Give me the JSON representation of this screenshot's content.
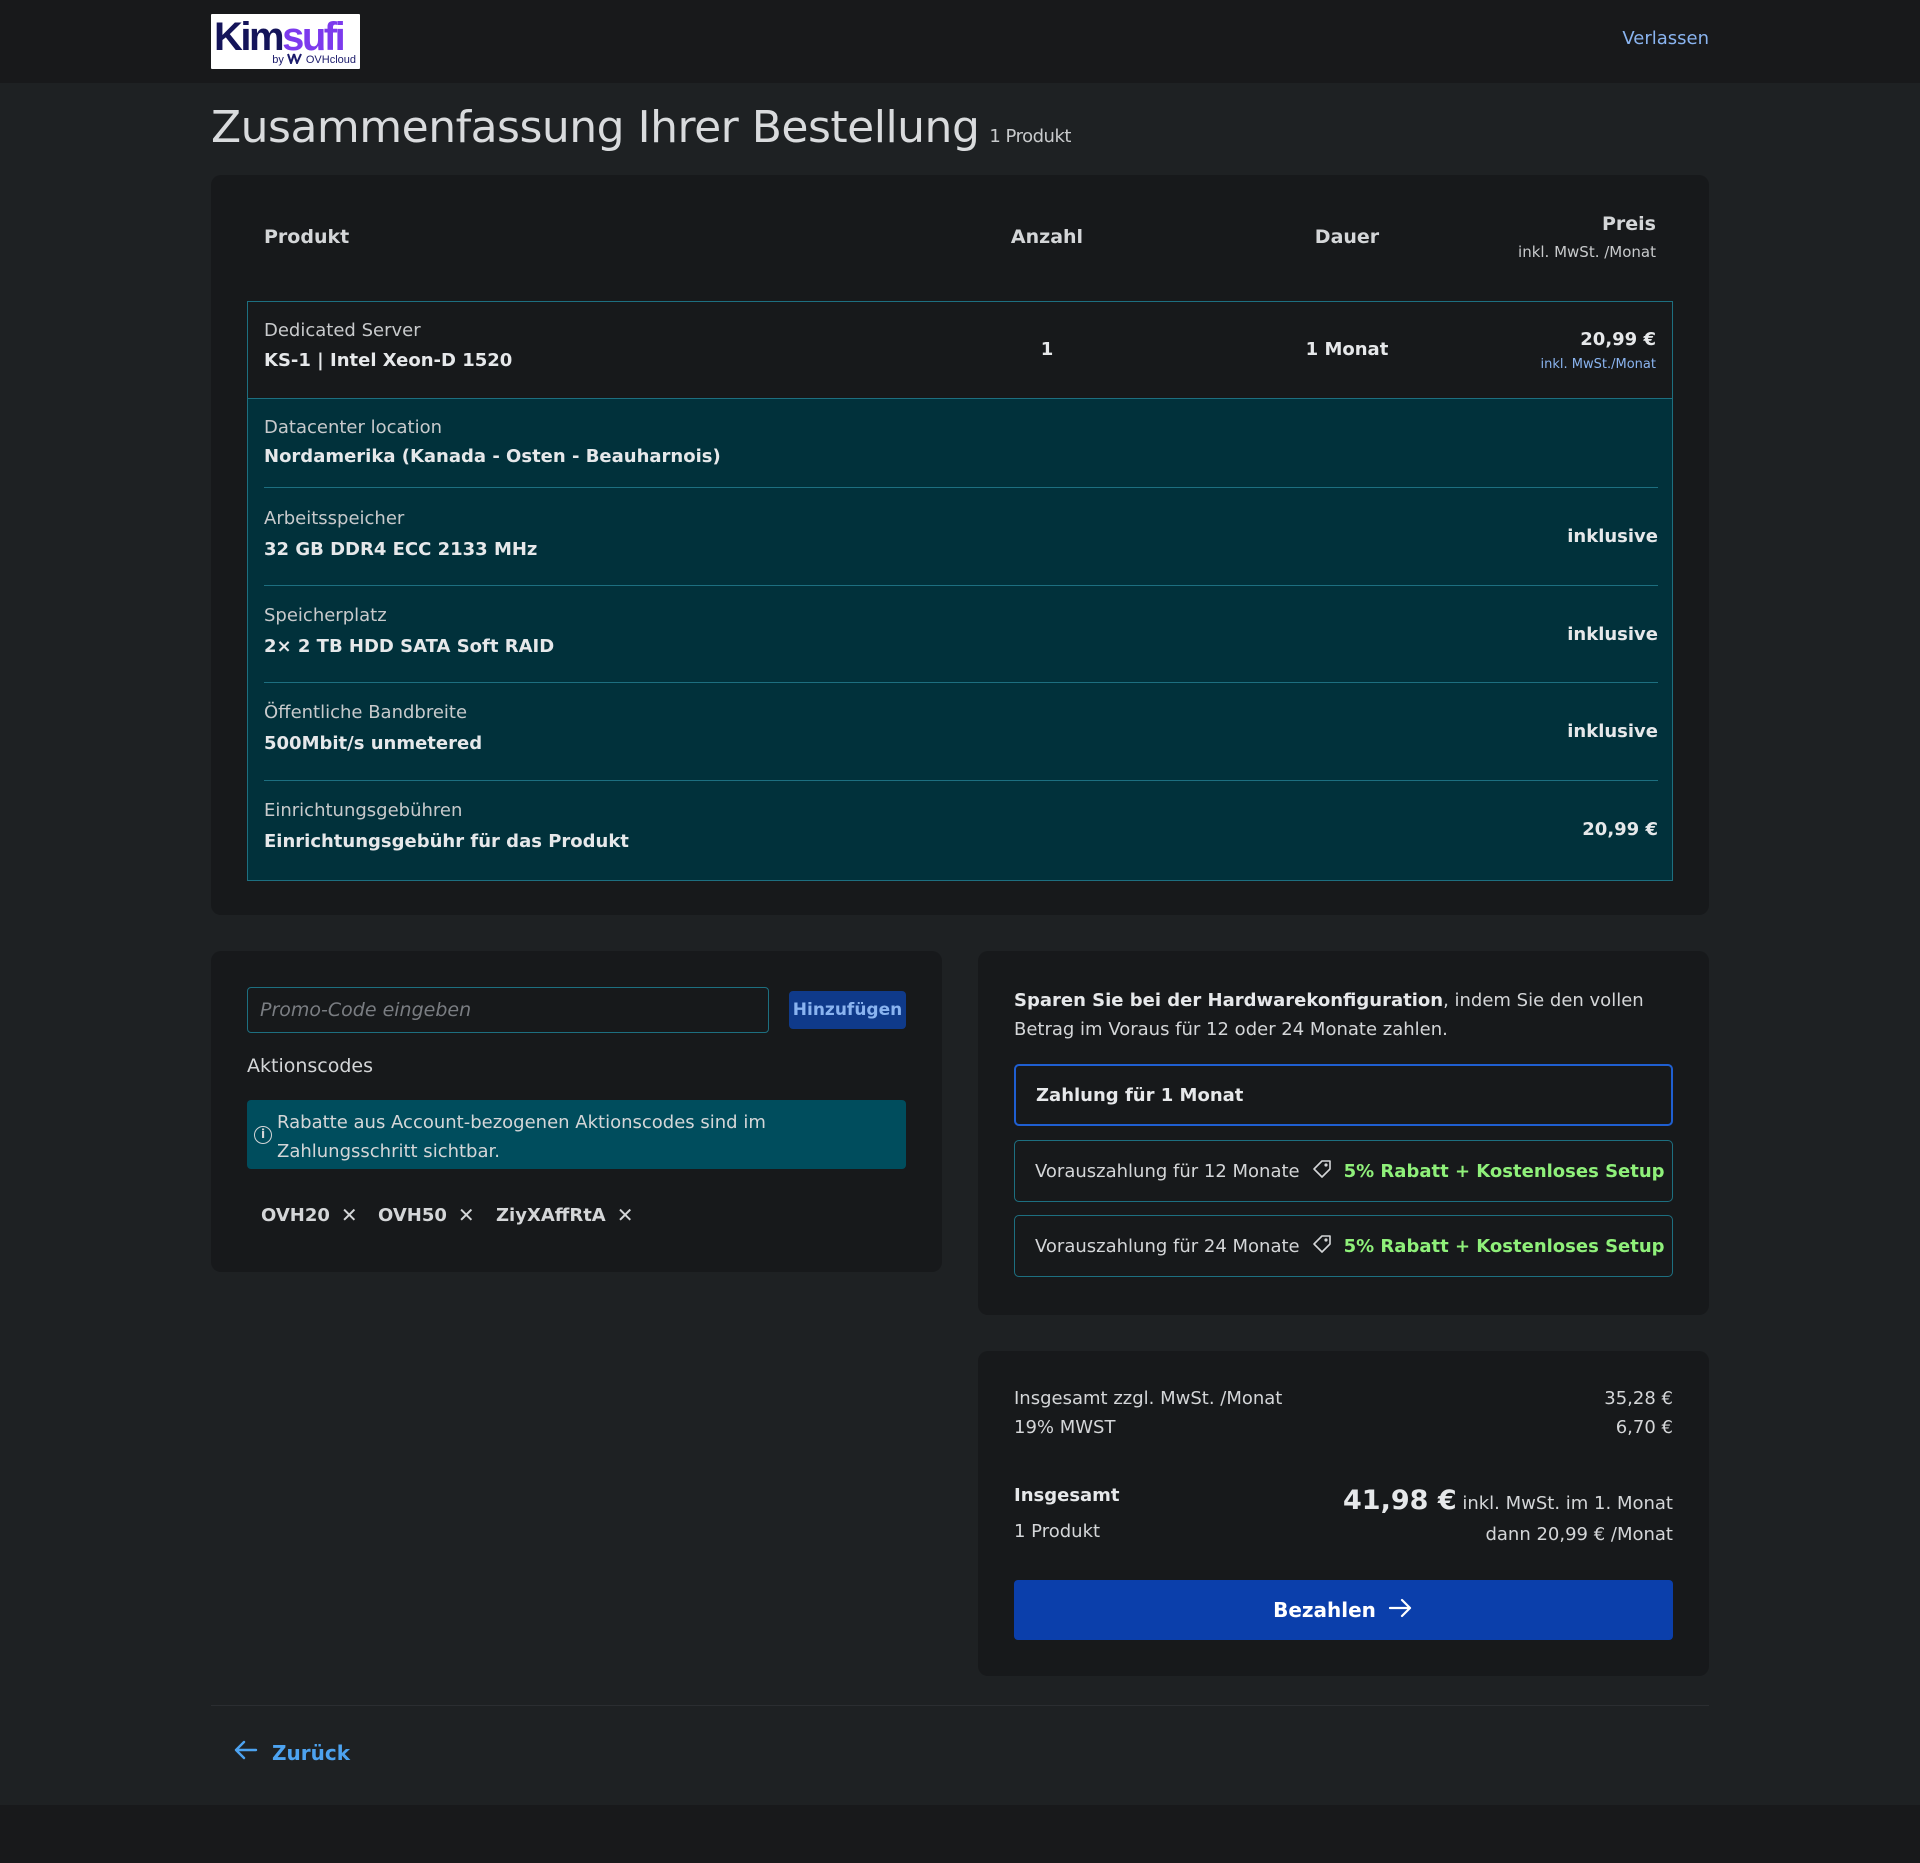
{
  "header": {
    "logo_text_1": "Kim",
    "logo_text_2": "sufi",
    "logo_by": "by",
    "logo_company": "OVHcloud",
    "exit_label": "Verlassen"
  },
  "page": {
    "title": "Zusammenfassung Ihrer Bestellung",
    "product_count": "1 Produkt"
  },
  "order_table": {
    "col_product": "Produkt",
    "col_quantity": "Anzahl",
    "col_duration": "Dauer",
    "col_price": "Preis",
    "col_price_sub": "inkl. MwSt. /Monat",
    "main": {
      "category": "Dedicated Server",
      "name": "KS-1 | Intel Xeon-D 1520",
      "quantity": "1",
      "duration": "1 Monat",
      "price": "20,99 €",
      "price_sub": "inkl. MwSt./Monat"
    },
    "options": [
      {
        "label": "Datacenter location",
        "value": "Nordamerika (Kanada - Osten - Beauharnois)",
        "price": ""
      },
      {
        "label": "Arbeitsspeicher",
        "value": "32 GB DDR4 ECC 2133 MHz",
        "price": "inklusive"
      },
      {
        "label": "Speicherplatz",
        "value": "2× 2 TB HDD SATA Soft RAID",
        "price": "inklusive"
      },
      {
        "label": "Öffentliche Bandbreite",
        "value": "500Mbit/s unmetered",
        "price": "inklusive"
      },
      {
        "label": "Einrichtungsgebühren",
        "value": "Einrichtungsgebühr für das Produkt",
        "price": "20,99 €"
      }
    ]
  },
  "promo": {
    "placeholder": "Promo-Code eingeben",
    "add_button": "Hinzufügen",
    "codes_label": "Aktionscodes",
    "info_text": "Rabatte aus Account-bezogenen Aktionscodes sind im Zahlungsschritt sichtbar.",
    "info_icon": "info-circle-icon",
    "codes": [
      "OVH20",
      "OVH50",
      "ZiyXAffRtA"
    ],
    "remove_glyph": "✕"
  },
  "savings": {
    "intro_bold": "Sparen Sie bei der Hardwarekonfiguration",
    "intro_rest": ", indem Sie den vollen Betrag im Voraus für 12 oder 24 Monate zahlen.",
    "options": [
      {
        "label": "Zahlung für 1 Monat",
        "promo": "",
        "selected": true
      },
      {
        "label": "Vorauszahlung für 12 Monate",
        "promo": "5% Rabatt + Kostenloses Setup",
        "selected": false
      },
      {
        "label": "Vorauszahlung für 24 Monate",
        "promo": "5% Rabatt + Kostenloses Setup",
        "selected": false
      }
    ],
    "tag_icon": "tag-icon",
    "promo_color": "#8ff07a",
    "selected_border": "#1f5fd1"
  },
  "totals": {
    "subtotal_label": "Insgesamt zzgl. MwSt. /Monat",
    "subtotal_value": "35,28 €",
    "vat_label": "19% MWST",
    "vat_value": "6,70 €",
    "total_label": "Insgesamt",
    "total_count": "1 Produkt",
    "total_amount": "41,98 €",
    "total_suffix": "inkl. MwSt. im 1. Monat",
    "then_text": "dann 20,99 € /Monat",
    "pay_button": "Bezahlen",
    "pay_color": "#0b3fab"
  },
  "footer_nav": {
    "back_label": "Zurück",
    "back_icon": "arrow-left-icon"
  },
  "colors": {
    "background": "#1e2123",
    "card": "#17191b",
    "option_bg": "#01313b",
    "accent_border": "#1d6f80",
    "link": "#8ab4f0",
    "back_link": "#4da3f0"
  }
}
